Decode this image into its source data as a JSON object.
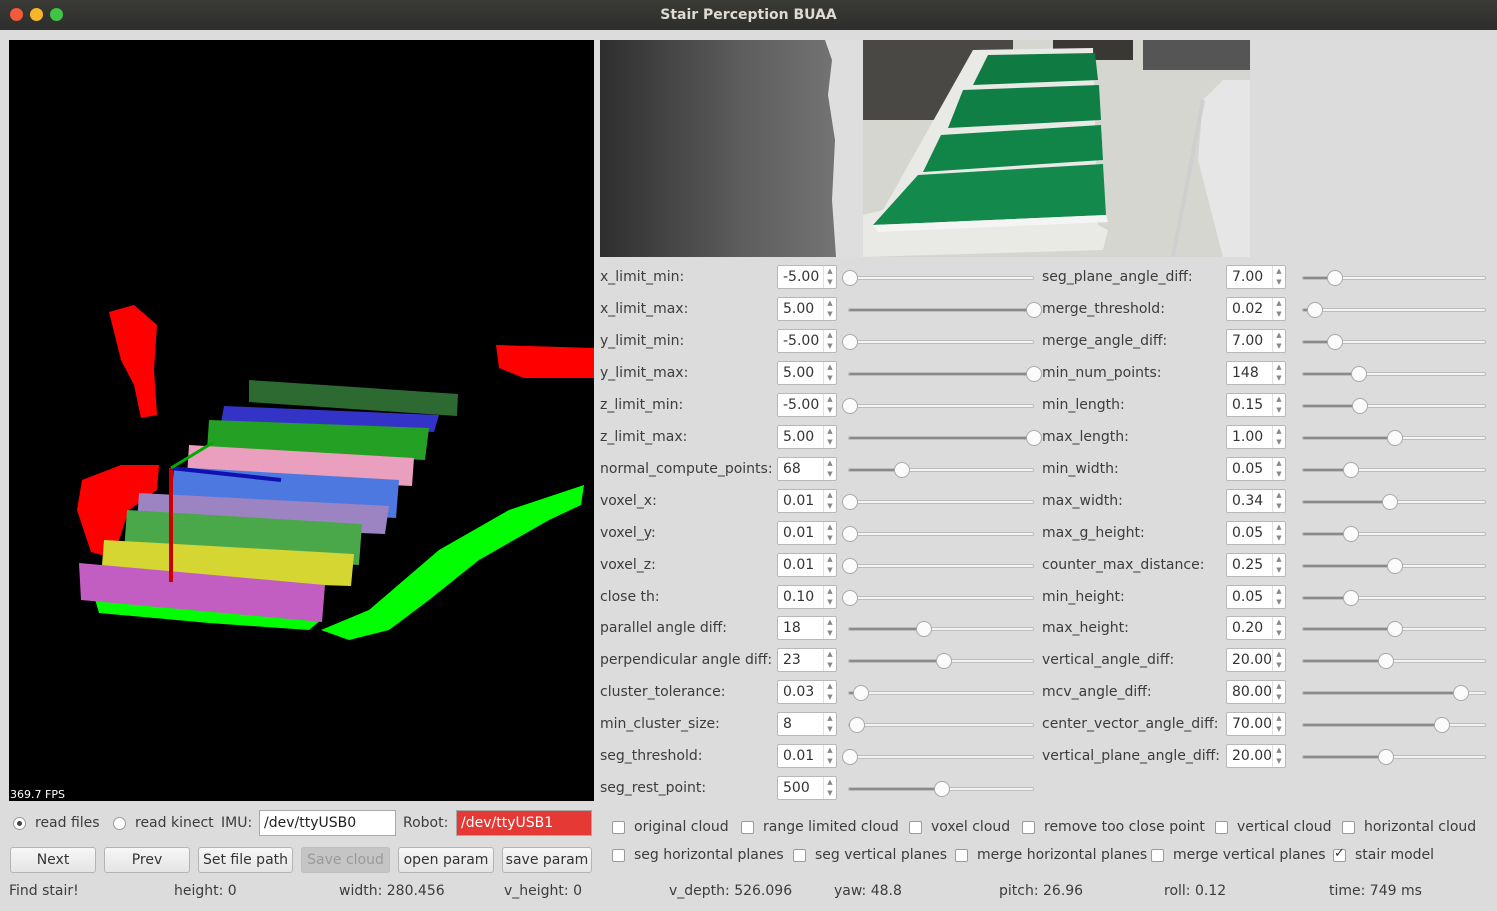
{
  "window": {
    "title": "Stair Perception BUAA"
  },
  "viewer": {
    "fps_text": "369.7 FPS"
  },
  "params_left": [
    {
      "label": "x_limit_min:",
      "value": "-5.00",
      "pct": 0
    },
    {
      "label": "x_limit_max:",
      "value": "5.00",
      "pct": 100
    },
    {
      "label": "y_limit_min:",
      "value": "-5.00",
      "pct": 0
    },
    {
      "label": "y_limit_max:",
      "value": "5.00",
      "pct": 100
    },
    {
      "label": "z_limit_min:",
      "value": "-5.00",
      "pct": 0
    },
    {
      "label": "z_limit_max:",
      "value": "5.00",
      "pct": 100
    },
    {
      "label": "normal_compute_points:",
      "value": "68",
      "pct": 28
    },
    {
      "label": "voxel_x:",
      "value": "0.01",
      "pct": 0
    },
    {
      "label": "voxel_y:",
      "value": "0.01",
      "pct": 0
    },
    {
      "label": "voxel_z:",
      "value": "0.01",
      "pct": 0
    },
    {
      "label": "close th:",
      "value": "0.10",
      "pct": 0
    },
    {
      "label": "parallel angle diff:",
      "value": "18",
      "pct": 40
    },
    {
      "label": "perpendicular angle diff:",
      "value": "23",
      "pct": 51
    },
    {
      "label": "cluster_tolerance:",
      "value": "0.03",
      "pct": 6
    },
    {
      "label": "min_cluster_size:",
      "value": "8",
      "pct": 4
    },
    {
      "label": "seg_threshold:",
      "value": "0.01",
      "pct": 0
    },
    {
      "label": "seg_rest_point:",
      "value": "500",
      "pct": 50
    }
  ],
  "params_right": [
    {
      "label": "seg_plane_angle_diff:",
      "value": "7.00",
      "pct": 17
    },
    {
      "label": "merge_threshold:",
      "value": "0.02",
      "pct": 6
    },
    {
      "label": "merge_angle_diff:",
      "value": "7.00",
      "pct": 17
    },
    {
      "label": "min_num_points:",
      "value": "148",
      "pct": 30
    },
    {
      "label": "min_length:",
      "value": "0.15",
      "pct": 31
    },
    {
      "label": "max_length:",
      "value": "1.00",
      "pct": 50
    },
    {
      "label": "min_width:",
      "value": "0.05",
      "pct": 26
    },
    {
      "label": "max_width:",
      "value": "0.34",
      "pct": 47
    },
    {
      "label": "max_g_height:",
      "value": "0.05",
      "pct": 26
    },
    {
      "label": "counter_max_distance:",
      "value": "0.25",
      "pct": 50
    },
    {
      "label": "min_height:",
      "value": "0.05",
      "pct": 26
    },
    {
      "label": "max_height:",
      "value": "0.20",
      "pct": 50
    },
    {
      "label": "vertical_angle_diff:",
      "value": "20.00",
      "pct": 45
    },
    {
      "label": "mcv_angle_diff:",
      "value": "80.00",
      "pct": 86
    },
    {
      "label": "center_vector_angle_diff:",
      "value": "70.00",
      "pct": 76
    },
    {
      "label": "vertical_plane_angle_diff:",
      "value": "20.00",
      "pct": 45
    }
  ],
  "source": {
    "read_files": "read files",
    "read_kinect": "read kinect",
    "imu_label": "IMU:",
    "imu_value": "/dev/ttyUSB0",
    "robot_label": "Robot:",
    "robot_value": "/dev/ttyUSB1"
  },
  "buttons": {
    "next": "Next",
    "prev": "Prev",
    "set_file_path": "Set file path",
    "save_cloud": "Save cloud",
    "open_param": "open param",
    "save_param": "save param"
  },
  "checkboxes_row1": [
    {
      "label": "original cloud",
      "checked": false
    },
    {
      "label": "range limited cloud",
      "checked": false
    },
    {
      "label": "voxel cloud",
      "checked": false
    },
    {
      "label": "remove too close point",
      "checked": false
    },
    {
      "label": "vertical cloud",
      "checked": false
    },
    {
      "label": "horizontal cloud",
      "checked": false
    }
  ],
  "checkboxes_row2": [
    {
      "label": "seg horizontal planes",
      "checked": false
    },
    {
      "label": "seg vertical planes",
      "checked": false
    },
    {
      "label": "merge horizontal planes",
      "checked": false
    },
    {
      "label": "merge vertical planes",
      "checked": false
    },
    {
      "label": "stair model",
      "checked": true
    }
  ],
  "status": {
    "result": "Find stair!",
    "height": "height: 0",
    "width": "width: 280.456",
    "v_height": "v_height: 0",
    "v_depth": "v_depth: 526.096",
    "yaw": "yaw: 48.8",
    "pitch": "pitch: 26.96",
    "roll": "roll: 0.12",
    "time": "time: 749 ms"
  }
}
